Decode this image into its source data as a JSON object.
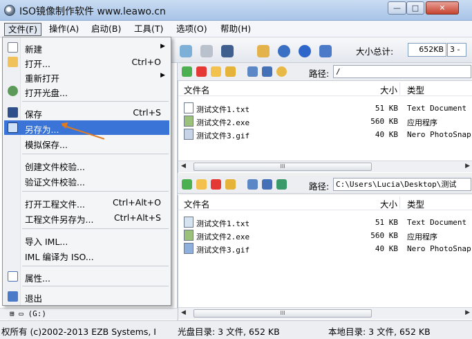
{
  "window": {
    "title": "ISO镜像制作软件 www.leawo.cn",
    "min_glyph": "—",
    "max_glyph": "□",
    "close_glyph": "✕"
  },
  "menubar": [
    "文件(F)",
    "操作(A)",
    "启动(B)",
    "工具(T)",
    "选项(O)",
    "帮助(H)"
  ],
  "toolbar": {
    "size_label": "大小总计:",
    "size_value": "652KB",
    "spin_text": "3 -"
  },
  "file_menu": {
    "items": [
      {
        "label": "新建",
        "shortcut": "",
        "submenu": true
      },
      {
        "label": "打开...",
        "shortcut": "Ctrl+O",
        "submenu": false
      },
      {
        "label": "重新打开",
        "shortcut": "",
        "submenu": true
      },
      {
        "label": "打开光盘...",
        "shortcut": "",
        "submenu": false
      },
      {
        "label": "保存",
        "shortcut": "Ctrl+S",
        "submenu": false
      },
      {
        "label": "另存为...",
        "shortcut": "",
        "submenu": false
      },
      {
        "label": "模拟保存...",
        "shortcut": "",
        "submenu": false
      },
      {
        "label": "创建文件校验...",
        "shortcut": "",
        "submenu": false
      },
      {
        "label": "验证文件校验...",
        "shortcut": "",
        "submenu": false
      },
      {
        "label": "打开工程文件...",
        "shortcut": "Ctrl+Alt+O",
        "submenu": false
      },
      {
        "label": "工程文件另存为...",
        "shortcut": "Ctrl+Alt+S",
        "submenu": false
      },
      {
        "label": "导入 IML...",
        "shortcut": "",
        "submenu": false
      },
      {
        "label": "IML 编译为 ISO...",
        "shortcut": "",
        "submenu": false
      },
      {
        "label": "属性...",
        "shortcut": "",
        "submenu": false
      },
      {
        "label": "退出",
        "shortcut": "",
        "submenu": false
      }
    ],
    "highlighted_index": 5,
    "submenu_glyph": "▶"
  },
  "iso_pane": {
    "path_label": "路径:",
    "path": "/",
    "columns": {
      "name": "文件名",
      "size": "大小",
      "type": "类型"
    },
    "files": [
      {
        "name": "测试文件1.txt",
        "size": "51 KB",
        "type": "Text Document"
      },
      {
        "name": "测试文件2.exe",
        "size": "560 KB",
        "type": "应用程序"
      },
      {
        "name": "测试文件3.gif",
        "size": "40 KB",
        "type": "Nero PhotoSnap"
      }
    ]
  },
  "local_pane": {
    "path_label": "路径:",
    "path": "C:\\Users\\Lucia\\Desktop\\测试",
    "columns": {
      "name": "文件名",
      "size": "大小",
      "type": "类型"
    },
    "files": [
      {
        "name": "测试文件1.txt",
        "size": "51 KB",
        "type": "Text Document"
      },
      {
        "name": "测试文件2.exe",
        "size": "560 KB",
        "type": "应用程序"
      },
      {
        "name": "测试文件3.gif",
        "size": "40 KB",
        "type": "Nero PhotoSnap"
      }
    ]
  },
  "scroll": {
    "left": "◀",
    "right": "▶",
    "thumb": "III"
  },
  "tree": {
    "drive": "(G:)"
  },
  "statusbar": {
    "copyright": "权所有 (c)2002-2013 EZB Systems, I",
    "iso_summary": "光盘目录: 3 文件, 652 KB",
    "local_summary": "本地目录: 3 文件, 652 KB"
  },
  "colors": {
    "highlight": "#3a74d6",
    "annotation_arrow": "#e07a1f"
  }
}
